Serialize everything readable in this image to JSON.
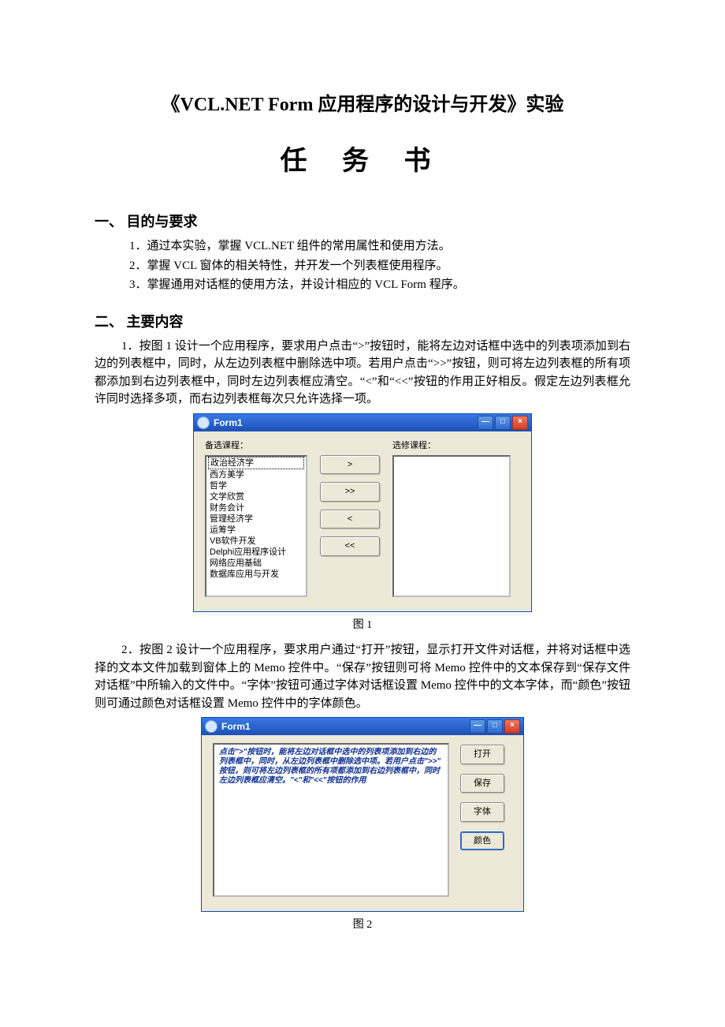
{
  "title_main": "《VCL.NET Form 应用程序的设计与开发》实验",
  "title_sub": "任 务 书",
  "section1": {
    "head": "一、 目的与要求",
    "items": [
      "1．通过本实验，掌握 VCL.NET 组件的常用属性和使用方法。",
      "2．掌握 VCL 窗体的相关特性，并开发一个列表框使用程序。",
      "3．掌握通用对话框的使用方法，并设计相应的 VCL Form 程序。"
    ]
  },
  "section2": {
    "head": "二、 主要内容",
    "para1": "1．按图 1 设计一个应用程序，要求用户点击“>”按钮时，能将左边对话框中选中的列表项添加到右边的列表框中，同时，从左边列表框中删除选中项。若用户点击“>>”按钮，则可将左边列表框的所有项都添加到右边列表框中，同时左边列表框应清空。“<”和“<<”按钮的作用正好相反。假定左边列表框允许同时选择多项，而右边列表框每次只允许选择一项。",
    "fig1_caption": "图 1",
    "para2": "2．按图 2 设计一个应用程序，要求用户通过“打开”按钮，显示打开文件对话框，并将对话框中选择的文本文件加载到窗体上的 Memo 控件中。“保存”按钮则可将 Memo 控件中的文本保存到“保存文件对话框”中所输入的文件中。“字体”按钮可通过字体对话框设置 Memo 控件中的文本字体，而“颜色”按钮则可通过颜色对话框设置 Memo 控件中的字体颜色。",
    "fig2_caption": "图 2"
  },
  "fig1": {
    "win_title": "Form1",
    "label_left": "备选课程：",
    "label_right": "选修课程：",
    "left_items": [
      "政治经济学",
      "西方美学",
      "哲学",
      "文学欣赏",
      "财务会计",
      "管理经济学",
      "运筹学",
      "VB软件开发",
      "Delphi应用程序设计",
      "网络应用基础",
      "数据库应用与开发"
    ],
    "btns": {
      "r1": ">",
      "r2": ">>",
      "l1": "<",
      "l2": "<<"
    }
  },
  "fig2": {
    "win_title": "Form1",
    "memo_lines": [
      "点击\">\"按钮时，能将左边对话框中选中的列表项添加到右边的",
      "列表框中，同时，从左边列表框中删除选中项。若用户点击\">>\"",
      "按钮，则可将左边列表框的所有项都添加到右边列表框中，同时",
      "左边列表框应清空。\"<\"和\"<<\"按钮的作用"
    ],
    "btns": {
      "open": "打开",
      "save": "保存",
      "font": "字体",
      "color": "颜色"
    }
  },
  "chrome": {
    "min": "—",
    "max": "□",
    "close": "×"
  }
}
